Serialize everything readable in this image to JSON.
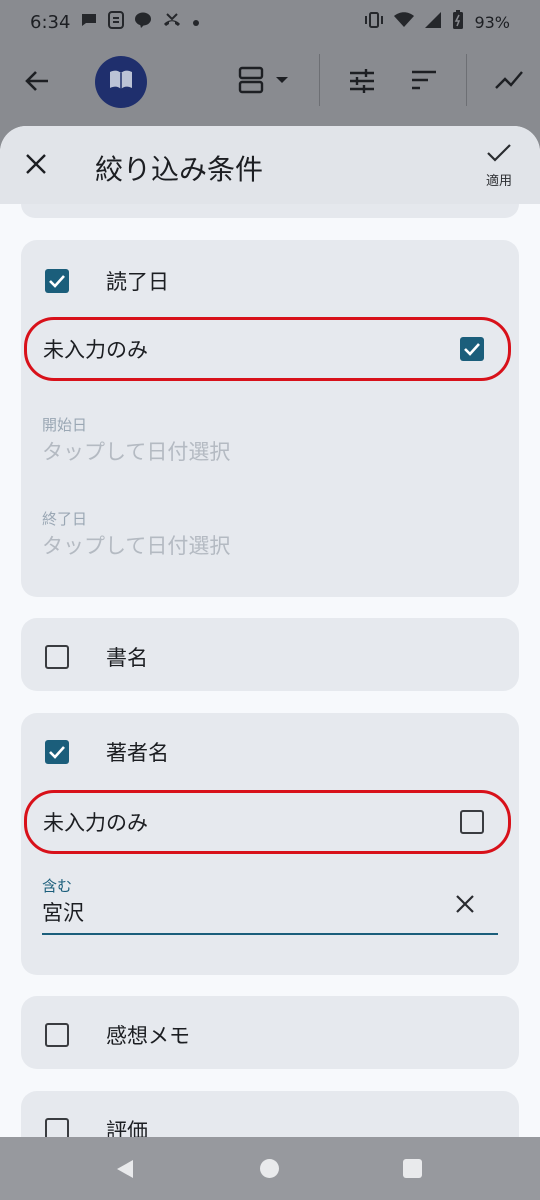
{
  "status_bar": {
    "time": "6:34",
    "battery_percent": "93%",
    "icons": [
      "chat-bubble-icon",
      "sync-icon",
      "line-app-icon",
      "missed-call-icon",
      "dot-icon",
      "vibrate-icon",
      "wifi-icon",
      "signal-icon",
      "battery-icon"
    ]
  },
  "app_bar": {
    "icons": [
      "arrow-back-icon",
      "book-icon",
      "view-layout-icon",
      "tune-icon",
      "sort-icon",
      "trending-icon"
    ]
  },
  "sheet": {
    "title": "絞り込み条件",
    "apply_label": "適用"
  },
  "filters": {
    "read_date": {
      "label": "読了日",
      "checked": true,
      "empty_only_label": "未入力のみ",
      "empty_only_checked": true,
      "start_label": "開始日",
      "start_placeholder": "タップして日付選択",
      "end_label": "終了日",
      "end_placeholder": "タップして日付選択"
    },
    "title": {
      "label": "書名",
      "checked": false
    },
    "author": {
      "label": "著者名",
      "checked": true,
      "empty_only_label": "未入力のみ",
      "empty_only_checked": false,
      "contains_label": "含む",
      "contains_value": "宮沢"
    },
    "memo": {
      "label": "感想メモ",
      "checked": false
    },
    "rating": {
      "label": "評価",
      "checked": false
    }
  },
  "colors": {
    "accent": "#1b5e7b",
    "highlight_border": "#d8111a",
    "avatar_bg": "#1f2f6d"
  }
}
